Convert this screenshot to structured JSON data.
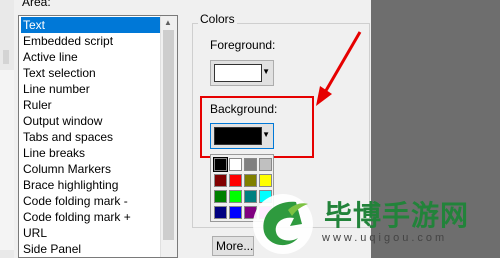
{
  "area_label": "Area:",
  "list": {
    "items": [
      "Text",
      "Embedded script",
      "Active line",
      "Text selection",
      "Line number",
      "Ruler",
      "Output window",
      "Tabs and spaces",
      "Line breaks",
      "Column Markers",
      "Brace highlighting",
      "Code folding mark -",
      "Code folding mark +",
      "URL",
      "Side Panel"
    ],
    "selected_index": 0
  },
  "colors": {
    "group_label": "Colors",
    "foreground_label": "Foreground:",
    "foreground_color": "#ffffff",
    "background_label": "Background:",
    "background_color": "#000000",
    "palette": [
      "#000000",
      "#ffffff",
      "#808080",
      "#c0c0c0",
      "#800000",
      "#ff0000",
      "#808000",
      "#ffff00",
      "#008000",
      "#00ff00",
      "#008080",
      "#00ffff",
      "#000080",
      "#0000ff",
      "#800080",
      "#ff00ff"
    ],
    "more_label": "More..."
  },
  "annotation_color": "#e60000",
  "watermark": {
    "title": "毕博手游网",
    "url": "www.uqigou.com"
  }
}
